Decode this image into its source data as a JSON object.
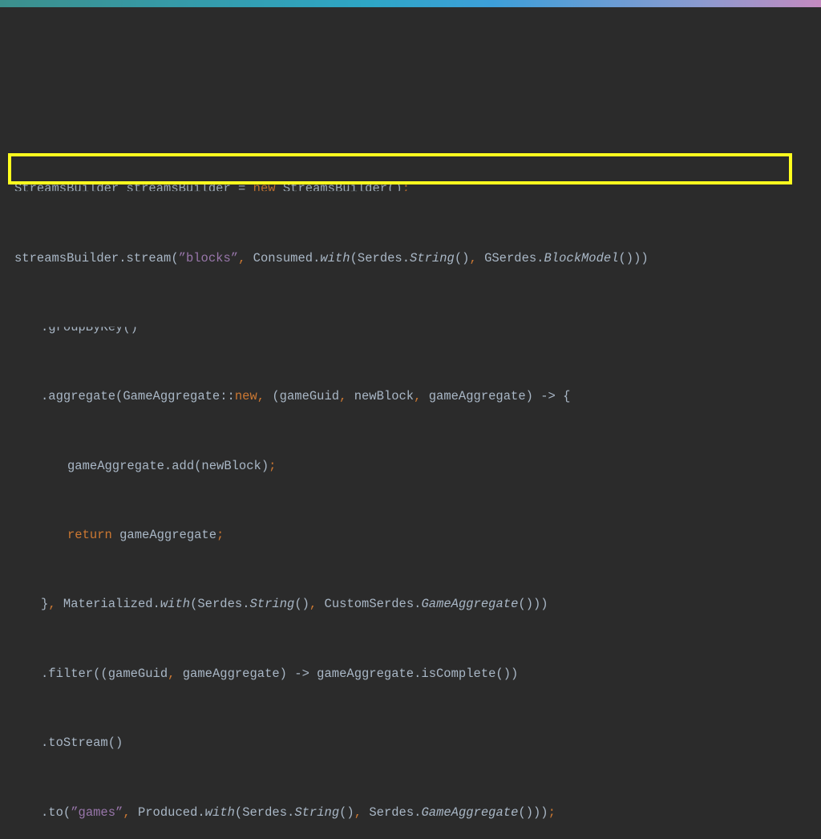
{
  "code": {
    "line1": {
      "a": "StreamsBuilder streamsBuilder = ",
      "kw": "new",
      "b": " StreamsBuilder()",
      "p": ";"
    },
    "line2": {
      "a": "streamsBuilder.stream(",
      "str": "”blocks”",
      "c1": ",",
      "b": " Consumed.",
      "with": "with",
      "c": "(Serdes.",
      "type1": "String",
      "d": "()",
      "c2": ",",
      "e": " GSerdes.",
      "type2": "BlockModel",
      "f": "()))"
    },
    "line3": {
      "a": ".groupByKey()"
    },
    "line4": {
      "a": ".aggregate(GameAggregate::",
      "kw": "new",
      "c1": ",",
      "b": " (gameGuid",
      "c2": ",",
      "c": " newBlock",
      "c3": ",",
      "d": " gameAggregate) -> {"
    },
    "line5": {
      "a": "gameAggregate.add(newBlock)",
      "p": ";"
    },
    "line6": {
      "kw": "return",
      "a": " gameAggregate",
      "p": ";"
    },
    "line7": {
      "a": "}",
      "c1": ",",
      "b": " Materialized.",
      "with": "with",
      "c": "(Serdes.",
      "type1": "String",
      "d": "()",
      "c2": ",",
      "e": " CustomSerdes.",
      "type2": "GameAggregate",
      "f": "()))"
    },
    "line8": {
      "a": ".filter((gameGuid",
      "c1": ",",
      "b": " gameAggregate) -> gameAggregate.isComplete())"
    },
    "line9": {
      "a": ".toStream()"
    },
    "line10": {
      "a": ".to(",
      "str": "”games”",
      "c1": ",",
      "b": " Produced.",
      "with": "with",
      "c": "(Serdes.",
      "type1": "String",
      "d": "()",
      "c2": ",",
      "e": " Serdes.",
      "type2": "GameAggregate",
      "f": "()))",
      "p": ";"
    }
  },
  "colors": {
    "background": "#2b2b2b",
    "default_text": "#a9b7c6",
    "keyword": "#cc7832",
    "string": "#9876aa",
    "highlight_box": "#ffff1e"
  }
}
